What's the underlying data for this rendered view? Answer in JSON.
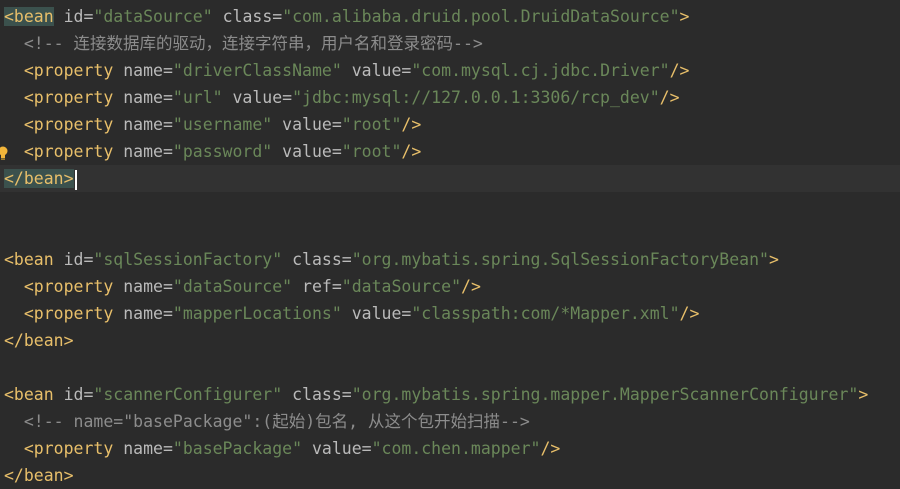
{
  "editor": {
    "lines": {
      "l0": {
        "tag": "<bean",
        "a1": "id=",
        "v1": "\"dataSource\"",
        "a2": "class=",
        "v2": "\"com.alibaba.druid.pool.DruidDataSource\"",
        "end": ">"
      },
      "l1": {
        "comment": "<!-- 连接数据库的驱动，连接字符串，用户名和登录密码-->"
      },
      "l2": {
        "tag": "<property",
        "a1": "name=",
        "v1": "\"driverClassName\"",
        "a2": "value=",
        "v2": "\"com.mysql.cj.jdbc.Driver\"",
        "end": "/>"
      },
      "l3": {
        "tag": "<property",
        "a1": "name=",
        "v1": "\"url\"",
        "a2": "value=",
        "v2": "\"jdbc:mysql://127.0.0.1:3306/rcp_dev\"",
        "end": "/>"
      },
      "l4": {
        "tag": "<property",
        "a1": "name=",
        "v1": "\"username\"",
        "a2": "value=",
        "v2": "\"root\"",
        "end": "/>"
      },
      "l5": {
        "tag": "<property",
        "a1": "name=",
        "v1": "\"password\"",
        "a2": "value=",
        "v2": "\"root\"",
        "end": "/>"
      },
      "l6": {
        "tag": "</bean>"
      },
      "l9": {
        "tag": "<bean",
        "a1": "id=",
        "v1": "\"sqlSessionFactory\"",
        "a2": "class=",
        "v2": "\"org.mybatis.spring.SqlSessionFactoryBean\"",
        "end": ">"
      },
      "l10": {
        "tag": "<property",
        "a1": "name=",
        "v1": "\"dataSource\"",
        "a2": "ref=",
        "v2": "\"dataSource\"",
        "end": "/>"
      },
      "l11": {
        "tag": "<property",
        "a1": "name=",
        "v1": "\"mapperLocations\"",
        "a2": "value=",
        "v2": "\"classpath:com/*Mapper.xml\"",
        "end": "/>"
      },
      "l12": {
        "tag": "</bean>"
      },
      "l14": {
        "tag": "<bean",
        "a1": "id=",
        "v1": "\"scannerConfigurer\"",
        "a2": "class=",
        "v2": "\"org.mybatis.spring.mapper.MapperScannerConfigurer\"",
        "end": ">"
      },
      "l15": {
        "comment": "<!-- name=\"basePackage\":(起始)包名, 从这个包开始扫描-->"
      },
      "l16": {
        "tag": "<property",
        "a1": "name=",
        "v1": "\"basePackage\"",
        "a2": "value=",
        "v2": "\"com.chen.mapper\"",
        "end": "/>"
      },
      "l17": {
        "tag": "</bean>"
      }
    },
    "icons": {
      "intention": "lightbulb-icon"
    },
    "colors": {
      "background": "#2b2b2b",
      "tag": "#e8bf6a",
      "attribute": "#bababa",
      "value": "#6a8759",
      "comment": "#8c8c8c"
    }
  }
}
